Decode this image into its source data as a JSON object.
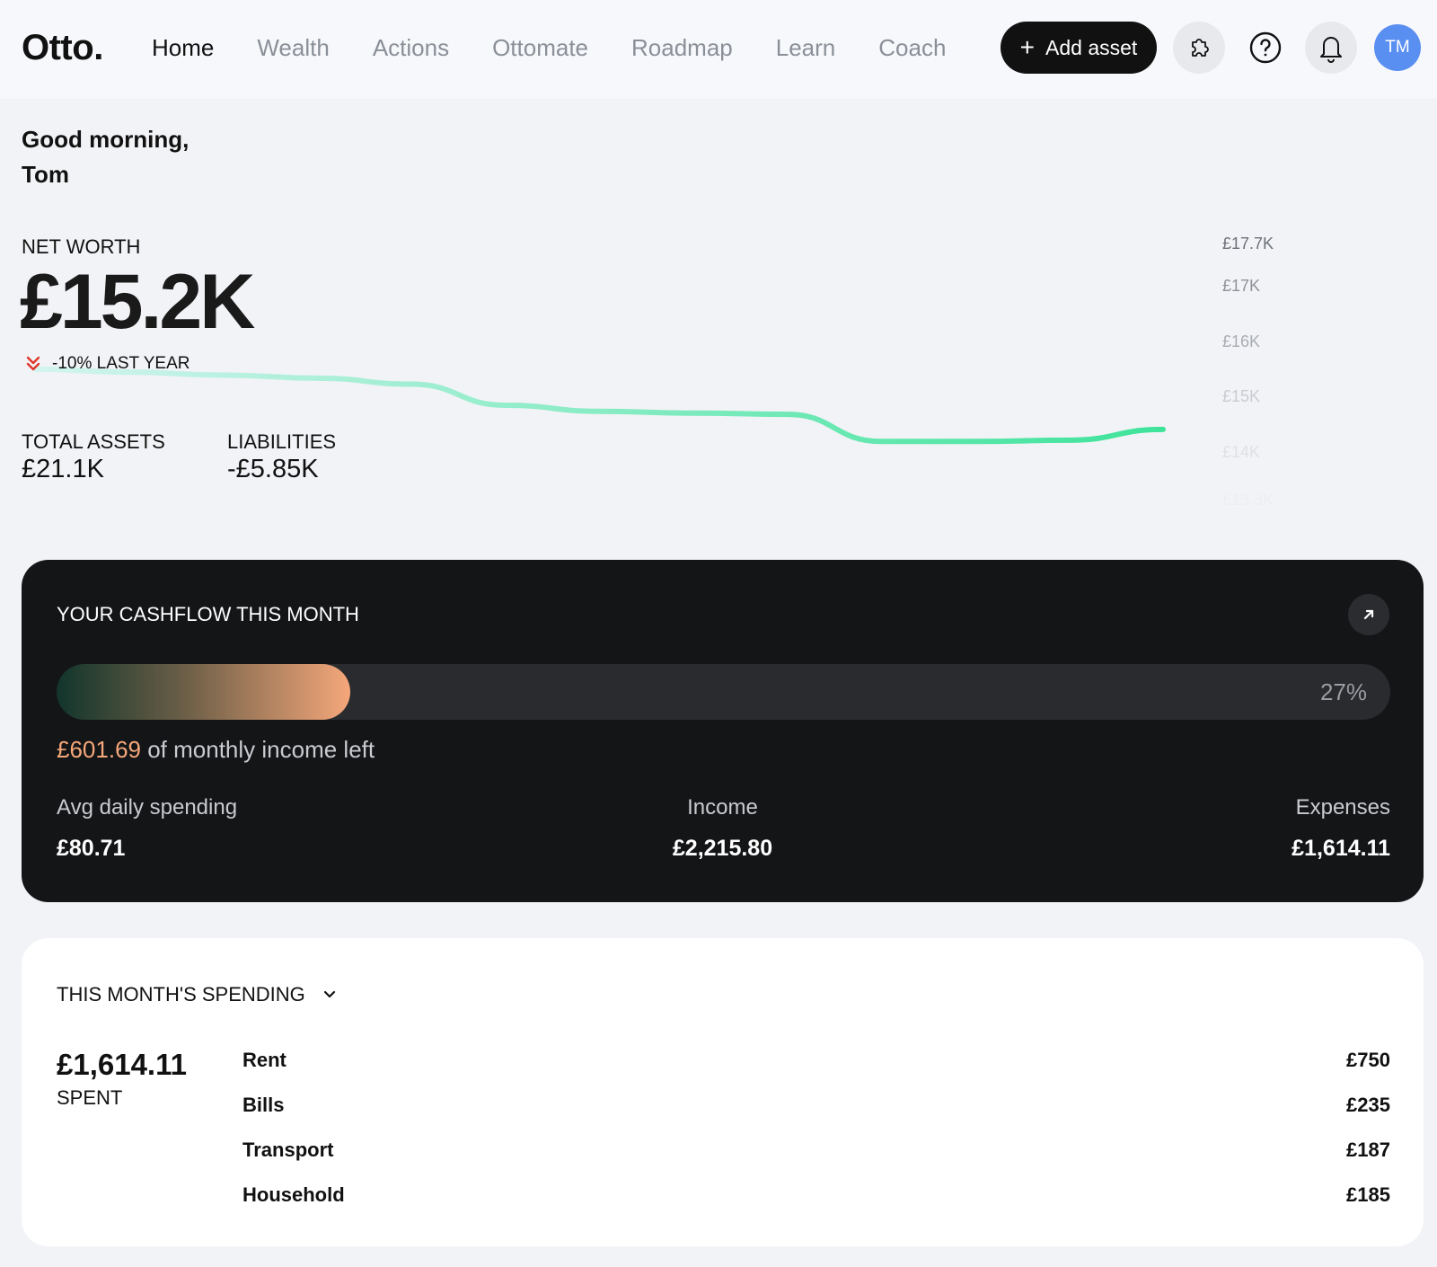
{
  "app": {
    "logo": "Otto."
  },
  "nav": {
    "items": [
      "Home",
      "Wealth",
      "Actions",
      "Ottomate",
      "Roadmap",
      "Learn",
      "Coach"
    ],
    "active": "Home"
  },
  "header": {
    "add_asset_label": "Add asset",
    "avatar_initials": "TM",
    "icons": [
      "puzzle-icon",
      "help-icon",
      "bell-icon"
    ]
  },
  "greeting": {
    "line1": "Good morning,",
    "line2": "Tom"
  },
  "net_worth": {
    "label": "NET WORTH",
    "value": "£15.2K",
    "change": "-10% LAST YEAR",
    "change_direction": "down",
    "total_assets_label": "TOTAL ASSETS",
    "total_assets": "£21.1K",
    "liabilities_label": "LIABILITIES",
    "liabilities": "-£5.85K"
  },
  "chart_data": {
    "type": "line",
    "title": "",
    "xlabel": "",
    "ylabel": "",
    "y_ticks": [
      "£17.7K",
      "£17K",
      "£16K",
      "£15K",
      "£14K",
      "£13.3K"
    ],
    "ylim": [
      13300,
      17700
    ],
    "grid": false,
    "x": [
      0,
      1,
      2,
      3,
      4,
      5,
      6,
      7,
      8,
      9,
      10,
      11,
      12
    ],
    "series": [
      {
        "values": [
          15600,
          15550,
          15500,
          15450,
          15350,
          15000,
          14900,
          14870,
          14850,
          14400,
          14400,
          14420,
          14600
        ]
      }
    ],
    "colors": {
      "line_start": "#c6f1ea",
      "line_end": "#3ee39a"
    }
  },
  "cashflow": {
    "title": "YOUR CASHFLOW THIS MONTH",
    "percent_label": "27%",
    "percent_used": 0.21,
    "left_amount": "£601.69",
    "left_text": "of monthly income left",
    "avg_daily_label": "Avg daily spending",
    "avg_daily_value": "£80.71",
    "income_label": "Income",
    "income_value": "£2,215.80",
    "expenses_label": "Expenses",
    "expenses_value": "£1,614.11",
    "colors": {
      "accent": "#f5a77a",
      "card_bg": "#141517"
    }
  },
  "spending": {
    "title": "THIS MONTH'S SPENDING",
    "total": "£1,614.11",
    "total_label": "SPENT",
    "items": [
      {
        "label": "Rent",
        "amount": "£750"
      },
      {
        "label": "Bills",
        "amount": "£235"
      },
      {
        "label": "Transport",
        "amount": "£187"
      },
      {
        "label": "Household",
        "amount": "£185"
      }
    ]
  }
}
